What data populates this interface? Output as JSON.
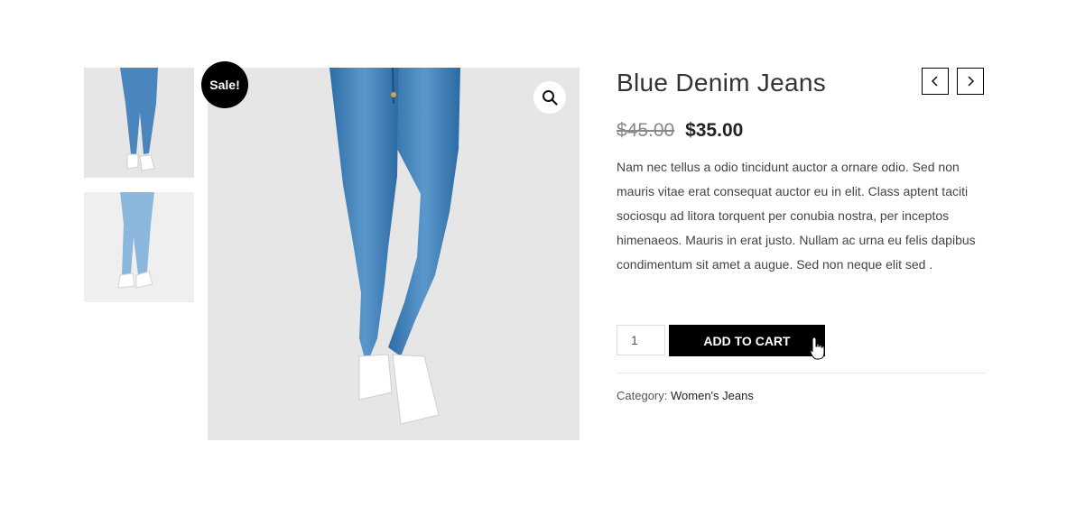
{
  "product": {
    "title": "Blue Denim Jeans",
    "sale_badge": "Sale!",
    "price_old": "$45.00",
    "price_new": "$35.00",
    "description": "Nam nec tellus a odio tincidunt auctor a ornare odio. Sed non mauris vitae erat consequat auctor eu in elit. Class aptent taciti sociosqu ad litora torquent per conubia nostra, per inceptos himenaeos. Mauris in erat justo. Nullam ac urna eu felis dapibus condimentum sit amet a augue. Sed non neque elit sed .",
    "quantity": "1",
    "add_to_cart_label": "ADD TO CART",
    "category_label": "Category:",
    "category_value": "Women's Jeans"
  },
  "icons": {
    "zoom": "magnifier-icon",
    "prev": "chevron-left-icon",
    "next": "chevron-right-icon",
    "cursor": "hand-pointer-icon"
  },
  "colors": {
    "badge_bg": "#000000",
    "button_bg": "#000000",
    "image_bg": "#e6e6e6",
    "denim": "#3f7fb6"
  }
}
